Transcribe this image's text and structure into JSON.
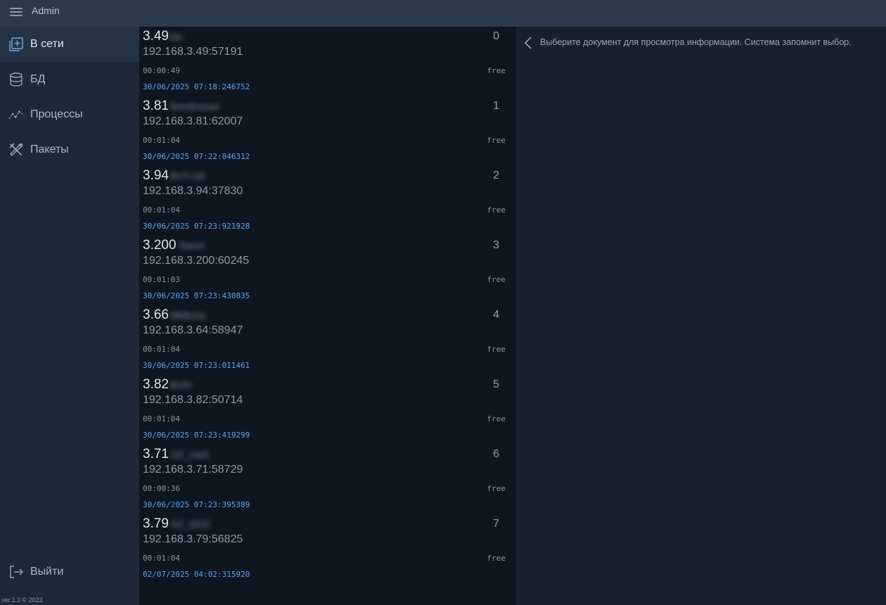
{
  "header": {
    "title": "Admin",
    "menu_icon": "hamburger-icon"
  },
  "sidebar": {
    "items": [
      {
        "label": "В сети",
        "icon": "add-box-icon",
        "active": true
      },
      {
        "label": "БД",
        "icon": "database-icon",
        "active": false
      },
      {
        "label": "Процессы",
        "icon": "chart-line-icon",
        "active": false
      },
      {
        "label": "Пакеты",
        "icon": "tools-icon",
        "active": false
      }
    ],
    "logout_label": "Выйти",
    "logout_icon": "logout-icon",
    "version": "ver.1.3 © 2023"
  },
  "sessions": [
    {
      "short": "3.49",
      "name": "Ido",
      "addr": "192.168.3.49:57191",
      "duration": "00:00:49",
      "timestamp": "30/06/2025 07:18:246752",
      "index": "0",
      "state": "free"
    },
    {
      "short": "3.81",
      "name": "Bandresaw",
      "addr": "192.168.3.81:62007",
      "duration": "00:01:04",
      "timestamp": "30/06/2025 07:22:046312",
      "index": "1",
      "state": "free"
    },
    {
      "short": "3.94",
      "name": "BVT-GE",
      "addr": "192.168.3.94:37830",
      "duration": "00:01:04",
      "timestamp": "30/06/2025 07:23:921928",
      "index": "2",
      "state": "free"
    },
    {
      "short": "3.200",
      "name": "Gierm",
      "addr": "192.168.3.200:60245",
      "duration": "00:01:03",
      "timestamp": "30/06/2025 07:23:430835",
      "index": "3",
      "state": "free"
    },
    {
      "short": "3.66",
      "name": "MkBosa",
      "addr": "192.168.3.64:58947",
      "duration": "00:01:04",
      "timestamp": "30/06/2025 07:23:011461",
      "index": "4",
      "state": "free"
    },
    {
      "short": "3.82",
      "name": "BUH",
      "addr": "192.168.3.82:50714",
      "duration": "00:01:04",
      "timestamp": "30/06/2025 07:23:419299",
      "index": "5",
      "state": "free"
    },
    {
      "short": "3.71",
      "name": "GZ_card",
      "addr": "192.168.3.71:58729",
      "duration": "00:00:36",
      "timestamp": "30/06/2025 07:23:395389",
      "index": "6",
      "state": "free"
    },
    {
      "short": "3.79",
      "name": "GZ_DOC",
      "addr": "192.168.3.79:56825",
      "duration": "00:01:04",
      "timestamp": "02/07/2025 04:02:315920",
      "index": "7",
      "state": "free"
    }
  ],
  "detail": {
    "hint": "Выберите документ для просмотра информации. Система запомнит выбор.",
    "back_icon": "chevron-left-icon"
  },
  "colors": {
    "topbar": "#2c3a4c",
    "sidebar": "#1d2937",
    "sidebar_active": "#253345",
    "list_bg": "#0e1620",
    "timestamp": "#5aa7f0"
  }
}
